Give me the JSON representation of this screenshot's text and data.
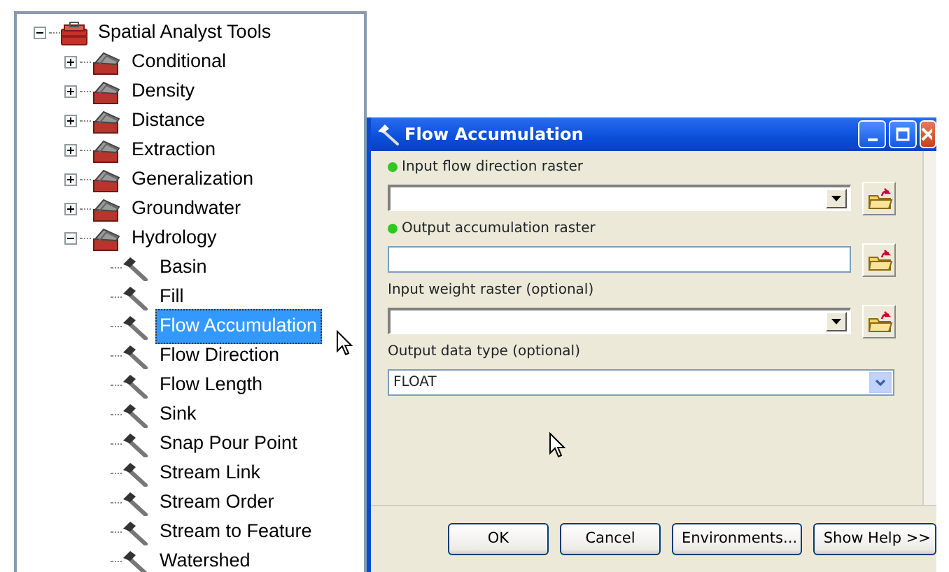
{
  "tree": {
    "items": [
      {
        "label": "Spatial Analyst Tools",
        "kind": "toolbox",
        "expanded": true,
        "selected": false,
        "children": [
          {
            "label": "Conditional",
            "kind": "toolset",
            "expanded": false,
            "selected": false
          },
          {
            "label": "Density",
            "kind": "toolset",
            "expanded": false,
            "selected": false
          },
          {
            "label": "Distance",
            "kind": "toolset",
            "expanded": false,
            "selected": false
          },
          {
            "label": "Extraction",
            "kind": "toolset",
            "expanded": false,
            "selected": false
          },
          {
            "label": "Generalization",
            "kind": "toolset",
            "expanded": false,
            "selected": false
          },
          {
            "label": "Groundwater",
            "kind": "toolset",
            "expanded": false,
            "selected": false
          },
          {
            "label": "Hydrology",
            "kind": "toolset",
            "expanded": true,
            "selected": false,
            "children": [
              {
                "label": "Basin",
                "kind": "tool",
                "selected": false
              },
              {
                "label": "Fill",
                "kind": "tool",
                "selected": false
              },
              {
                "label": "Flow Accumulation",
                "kind": "tool",
                "selected": true
              },
              {
                "label": "Flow Direction",
                "kind": "tool",
                "selected": false
              },
              {
                "label": "Flow Length",
                "kind": "tool",
                "selected": false
              },
              {
                "label": "Sink",
                "kind": "tool",
                "selected": false
              },
              {
                "label": "Snap Pour Point",
                "kind": "tool",
                "selected": false
              },
              {
                "label": "Stream Link",
                "kind": "tool",
                "selected": false
              },
              {
                "label": "Stream Order",
                "kind": "tool",
                "selected": false
              },
              {
                "label": "Stream to Feature",
                "kind": "tool",
                "selected": false
              },
              {
                "label": "Watershed",
                "kind": "tool",
                "selected": false
              }
            ]
          }
        ]
      }
    ]
  },
  "dialog": {
    "title": "Flow Accumulation",
    "fields": [
      {
        "label": "Input flow direction raster",
        "kind": "combo",
        "required": true
      },
      {
        "label": "Output accumulation raster",
        "kind": "text",
        "required": true
      },
      {
        "label": "Input weight raster (optional)",
        "kind": "combo",
        "required": false
      },
      {
        "label": "Output data type (optional)",
        "kind": "select",
        "required": false,
        "value": "FLOAT"
      }
    ],
    "buttons": [
      "OK",
      "Cancel",
      "Environments...",
      "Show Help >>"
    ]
  }
}
